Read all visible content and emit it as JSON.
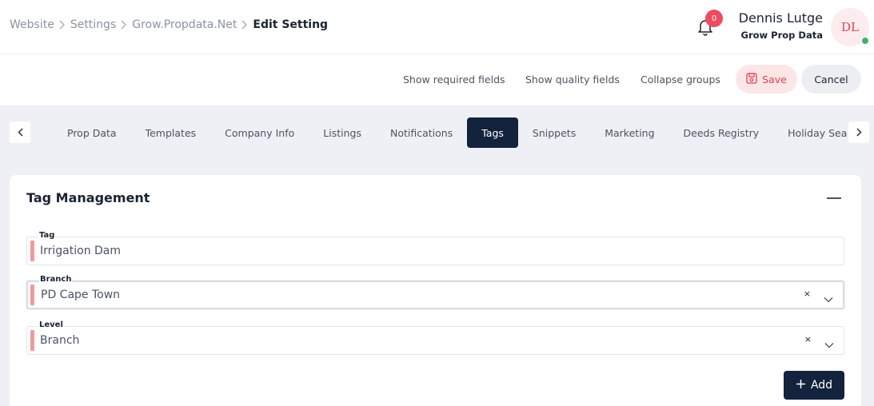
{
  "breadcrumb": {
    "items": [
      "Website",
      "Settings",
      "Grow.Propdata.Net"
    ],
    "current": "Edit Setting"
  },
  "notifications": {
    "count": "0"
  },
  "user": {
    "name": "Dennis Lutge",
    "org": "Grow Prop Data",
    "initials": "DL"
  },
  "actions": {
    "show_required": "Show required fields",
    "show_quality": "Show quality fields",
    "collapse_groups": "Collapse groups",
    "save": "Save",
    "cancel": "Cancel"
  },
  "tabs": [
    "Prop Data",
    "Templates",
    "Company Info",
    "Listings",
    "Notifications",
    "Tags",
    "Snippets",
    "Marketing",
    "Deeds Registry",
    "Holiday Season"
  ],
  "active_tab": "Tags",
  "card": {
    "title": "Tag Management",
    "fields": {
      "tag": {
        "label": "Tag",
        "value": "Irrigation Dam"
      },
      "branch": {
        "label": "Branch",
        "value": "PD Cape Town",
        "clear": "×"
      },
      "level": {
        "label": "Level",
        "value": "Branch",
        "clear": "×"
      }
    },
    "add_button": "Add"
  },
  "colors": {
    "primary_dark": "#13223d",
    "accent_red": "#e0424f",
    "required_marker": "#f2999f",
    "online": "#43b06a"
  }
}
